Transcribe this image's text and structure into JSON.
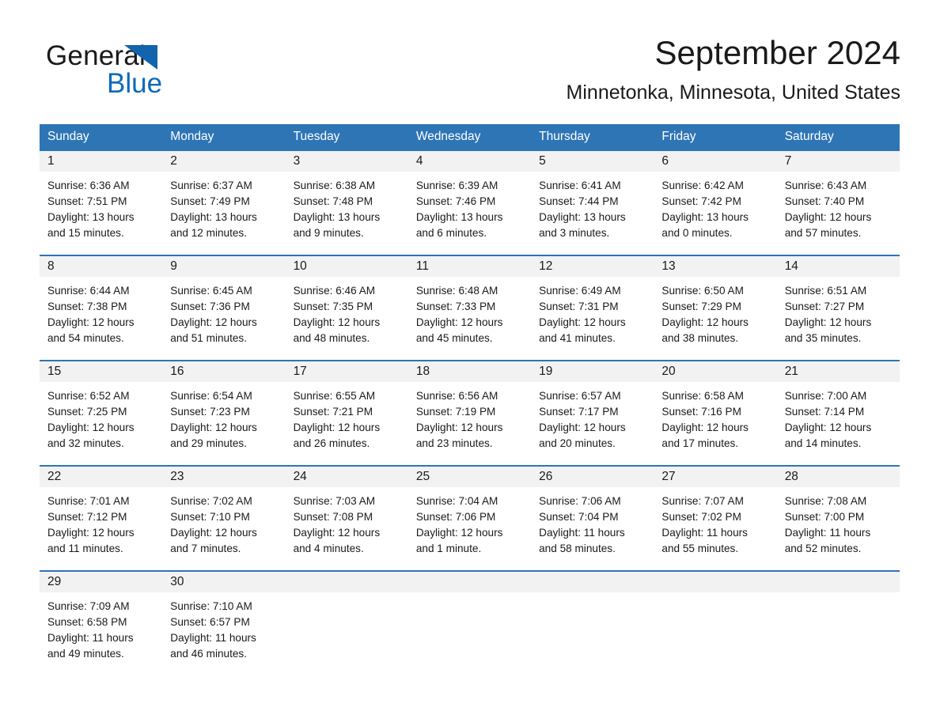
{
  "brand": {
    "name_part1": "General",
    "name_part2": "Blue",
    "triangle_color": "#1164ad",
    "blue_text_color": "#0e6ab8"
  },
  "header": {
    "month_title": "September 2024",
    "location": "Minnetonka, Minnesota, United States"
  },
  "theme": {
    "header_blue": "#2e75b6",
    "daynum_band": "#f2f2f2",
    "text": "#1a1a1a"
  },
  "weekdays": [
    "Sunday",
    "Monday",
    "Tuesday",
    "Wednesday",
    "Thursday",
    "Friday",
    "Saturday"
  ],
  "weeks": [
    {
      "days": [
        {
          "date": "1",
          "sunrise": "Sunrise: 6:36 AM",
          "sunset": "Sunset: 7:51 PM",
          "daylight_l1": "Daylight: 13 hours",
          "daylight_l2": "and 15 minutes."
        },
        {
          "date": "2",
          "sunrise": "Sunrise: 6:37 AM",
          "sunset": "Sunset: 7:49 PM",
          "daylight_l1": "Daylight: 13 hours",
          "daylight_l2": "and 12 minutes."
        },
        {
          "date": "3",
          "sunrise": "Sunrise: 6:38 AM",
          "sunset": "Sunset: 7:48 PM",
          "daylight_l1": "Daylight: 13 hours",
          "daylight_l2": "and 9 minutes."
        },
        {
          "date": "4",
          "sunrise": "Sunrise: 6:39 AM",
          "sunset": "Sunset: 7:46 PM",
          "daylight_l1": "Daylight: 13 hours",
          "daylight_l2": "and 6 minutes."
        },
        {
          "date": "5",
          "sunrise": "Sunrise: 6:41 AM",
          "sunset": "Sunset: 7:44 PM",
          "daylight_l1": "Daylight: 13 hours",
          "daylight_l2": "and 3 minutes."
        },
        {
          "date": "6",
          "sunrise": "Sunrise: 6:42 AM",
          "sunset": "Sunset: 7:42 PM",
          "daylight_l1": "Daylight: 13 hours",
          "daylight_l2": "and 0 minutes."
        },
        {
          "date": "7",
          "sunrise": "Sunrise: 6:43 AM",
          "sunset": "Sunset: 7:40 PM",
          "daylight_l1": "Daylight: 12 hours",
          "daylight_l2": "and 57 minutes."
        }
      ]
    },
    {
      "days": [
        {
          "date": "8",
          "sunrise": "Sunrise: 6:44 AM",
          "sunset": "Sunset: 7:38 PM",
          "daylight_l1": "Daylight: 12 hours",
          "daylight_l2": "and 54 minutes."
        },
        {
          "date": "9",
          "sunrise": "Sunrise: 6:45 AM",
          "sunset": "Sunset: 7:36 PM",
          "daylight_l1": "Daylight: 12 hours",
          "daylight_l2": "and 51 minutes."
        },
        {
          "date": "10",
          "sunrise": "Sunrise: 6:46 AM",
          "sunset": "Sunset: 7:35 PM",
          "daylight_l1": "Daylight: 12 hours",
          "daylight_l2": "and 48 minutes."
        },
        {
          "date": "11",
          "sunrise": "Sunrise: 6:48 AM",
          "sunset": "Sunset: 7:33 PM",
          "daylight_l1": "Daylight: 12 hours",
          "daylight_l2": "and 45 minutes."
        },
        {
          "date": "12",
          "sunrise": "Sunrise: 6:49 AM",
          "sunset": "Sunset: 7:31 PM",
          "daylight_l1": "Daylight: 12 hours",
          "daylight_l2": "and 41 minutes."
        },
        {
          "date": "13",
          "sunrise": "Sunrise: 6:50 AM",
          "sunset": "Sunset: 7:29 PM",
          "daylight_l1": "Daylight: 12 hours",
          "daylight_l2": "and 38 minutes."
        },
        {
          "date": "14",
          "sunrise": "Sunrise: 6:51 AM",
          "sunset": "Sunset: 7:27 PM",
          "daylight_l1": "Daylight: 12 hours",
          "daylight_l2": "and 35 minutes."
        }
      ]
    },
    {
      "days": [
        {
          "date": "15",
          "sunrise": "Sunrise: 6:52 AM",
          "sunset": "Sunset: 7:25 PM",
          "daylight_l1": "Daylight: 12 hours",
          "daylight_l2": "and 32 minutes."
        },
        {
          "date": "16",
          "sunrise": "Sunrise: 6:54 AM",
          "sunset": "Sunset: 7:23 PM",
          "daylight_l1": "Daylight: 12 hours",
          "daylight_l2": "and 29 minutes."
        },
        {
          "date": "17",
          "sunrise": "Sunrise: 6:55 AM",
          "sunset": "Sunset: 7:21 PM",
          "daylight_l1": "Daylight: 12 hours",
          "daylight_l2": "and 26 minutes."
        },
        {
          "date": "18",
          "sunrise": "Sunrise: 6:56 AM",
          "sunset": "Sunset: 7:19 PM",
          "daylight_l1": "Daylight: 12 hours",
          "daylight_l2": "and 23 minutes."
        },
        {
          "date": "19",
          "sunrise": "Sunrise: 6:57 AM",
          "sunset": "Sunset: 7:17 PM",
          "daylight_l1": "Daylight: 12 hours",
          "daylight_l2": "and 20 minutes."
        },
        {
          "date": "20",
          "sunrise": "Sunrise: 6:58 AM",
          "sunset": "Sunset: 7:16 PM",
          "daylight_l1": "Daylight: 12 hours",
          "daylight_l2": "and 17 minutes."
        },
        {
          "date": "21",
          "sunrise": "Sunrise: 7:00 AM",
          "sunset": "Sunset: 7:14 PM",
          "daylight_l1": "Daylight: 12 hours",
          "daylight_l2": "and 14 minutes."
        }
      ]
    },
    {
      "days": [
        {
          "date": "22",
          "sunrise": "Sunrise: 7:01 AM",
          "sunset": "Sunset: 7:12 PM",
          "daylight_l1": "Daylight: 12 hours",
          "daylight_l2": "and 11 minutes."
        },
        {
          "date": "23",
          "sunrise": "Sunrise: 7:02 AM",
          "sunset": "Sunset: 7:10 PM",
          "daylight_l1": "Daylight: 12 hours",
          "daylight_l2": "and 7 minutes."
        },
        {
          "date": "24",
          "sunrise": "Sunrise: 7:03 AM",
          "sunset": "Sunset: 7:08 PM",
          "daylight_l1": "Daylight: 12 hours",
          "daylight_l2": "and 4 minutes."
        },
        {
          "date": "25",
          "sunrise": "Sunrise: 7:04 AM",
          "sunset": "Sunset: 7:06 PM",
          "daylight_l1": "Daylight: 12 hours",
          "daylight_l2": "and 1 minute."
        },
        {
          "date": "26",
          "sunrise": "Sunrise: 7:06 AM",
          "sunset": "Sunset: 7:04 PM",
          "daylight_l1": "Daylight: 11 hours",
          "daylight_l2": "and 58 minutes."
        },
        {
          "date": "27",
          "sunrise": "Sunrise: 7:07 AM",
          "sunset": "Sunset: 7:02 PM",
          "daylight_l1": "Daylight: 11 hours",
          "daylight_l2": "and 55 minutes."
        },
        {
          "date": "28",
          "sunrise": "Sunrise: 7:08 AM",
          "sunset": "Sunset: 7:00 PM",
          "daylight_l1": "Daylight: 11 hours",
          "daylight_l2": "and 52 minutes."
        }
      ]
    },
    {
      "days": [
        {
          "date": "29",
          "sunrise": "Sunrise: 7:09 AM",
          "sunset": "Sunset: 6:58 PM",
          "daylight_l1": "Daylight: 11 hours",
          "daylight_l2": "and 49 minutes."
        },
        {
          "date": "30",
          "sunrise": "Sunrise: 7:10 AM",
          "sunset": "Sunset: 6:57 PM",
          "daylight_l1": "Daylight: 11 hours",
          "daylight_l2": "and 46 minutes."
        },
        {
          "date": "",
          "sunrise": "",
          "sunset": "",
          "daylight_l1": "",
          "daylight_l2": ""
        },
        {
          "date": "",
          "sunrise": "",
          "sunset": "",
          "daylight_l1": "",
          "daylight_l2": ""
        },
        {
          "date": "",
          "sunrise": "",
          "sunset": "",
          "daylight_l1": "",
          "daylight_l2": ""
        },
        {
          "date": "",
          "sunrise": "",
          "sunset": "",
          "daylight_l1": "",
          "daylight_l2": ""
        },
        {
          "date": "",
          "sunrise": "",
          "sunset": "",
          "daylight_l1": "",
          "daylight_l2": ""
        }
      ]
    }
  ]
}
